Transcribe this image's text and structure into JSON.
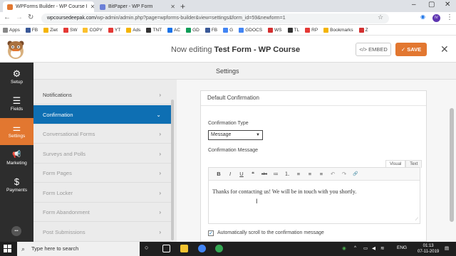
{
  "browser": {
    "tabs": [
      {
        "title": "WPForms Builder - WP Course I",
        "favicon_color": "#e27730",
        "active": true
      },
      {
        "title": "BitPaper - WP Form",
        "favicon_color": "#6b7fd7",
        "active": false
      }
    ],
    "url_host": "wpcoursedeepak.com",
    "url_path": "/wp-admin/admin.php?page=wpforms-builder&view=settings&form_id=59&newform=1",
    "profile_initials": "IV",
    "bookmarks": [
      {
        "label": "Apps",
        "color": "#888888"
      },
      {
        "label": "FB",
        "color": "#3b5998"
      },
      {
        "label": "Ziet",
        "color": "#f4b400"
      },
      {
        "label": "SW",
        "color": "#e53935"
      },
      {
        "label": "COPY",
        "color": "#fbc02d"
      },
      {
        "label": "YT",
        "color": "#e53935"
      },
      {
        "label": "Ads",
        "color": "#f4b400"
      },
      {
        "label": "TNT",
        "color": "#333333"
      },
      {
        "label": "AC",
        "color": "#1a73e8"
      },
      {
        "label": "GD",
        "color": "#0f9d58"
      },
      {
        "label": "FB",
        "color": "#3b5998"
      },
      {
        "label": "G",
        "color": "#4285f4"
      },
      {
        "label": "GDOCS",
        "color": "#4285f4"
      },
      {
        "label": "WS",
        "color": "#d32f2f"
      },
      {
        "label": "TL",
        "color": "#333333"
      },
      {
        "label": "RP",
        "color": "#e53935"
      },
      {
        "label": "Bookmarks",
        "color": "#f4b400"
      },
      {
        "label": "Z",
        "color": "#d32f2f"
      }
    ]
  },
  "header": {
    "editing_prefix": "Now editing",
    "form_name": "Test Form - WP Course",
    "embed_label": "</> EMBED",
    "save_label": "✓ SAVE",
    "close_glyph": "✕"
  },
  "sidenav": [
    {
      "label": "Setup",
      "icon": "gear-icon",
      "glyph": "⚙",
      "active": false
    },
    {
      "label": "Fields",
      "icon": "list-icon",
      "glyph": "☰",
      "active": false
    },
    {
      "label": "Settings",
      "icon": "sliders-icon",
      "glyph": "⚌",
      "active": true
    },
    {
      "label": "Marketing",
      "icon": "megaphone-icon",
      "glyph": "📢",
      "active": false
    },
    {
      "label": "Payments",
      "icon": "dollar-icon",
      "glyph": "$",
      "active": false
    }
  ],
  "sidenav_more_glyph": "•••",
  "settings_title": "Settings",
  "panel_items": [
    {
      "label": "Notifications",
      "chevron": "›",
      "state": "normal"
    },
    {
      "label": "Confirmation",
      "chevron": "⌄",
      "state": "active"
    },
    {
      "label": "Conversational Forms",
      "chevron": "›",
      "state": "muted"
    },
    {
      "label": "Surveys and Polls",
      "chevron": "›",
      "state": "muted"
    },
    {
      "label": "Form Pages",
      "chevron": "›",
      "state": "muted"
    },
    {
      "label": "Form Locker",
      "chevron": "›",
      "state": "muted"
    },
    {
      "label": "Form Abandonment",
      "chevron": "›",
      "state": "muted"
    },
    {
      "label": "Post Submissions",
      "chevron": "›",
      "state": "muted"
    }
  ],
  "confirmation": {
    "section_title": "Default Confirmation",
    "type_label": "Confirmation Type",
    "type_value": "Message",
    "message_label": "Confirmation Message",
    "tab_visual": "Visual",
    "tab_text": "Text",
    "toolbar": [
      "B",
      "I",
      "U",
      "❝",
      "abc",
      "≔",
      "⒈",
      "≡",
      "≡",
      "≡",
      "↶",
      "↷",
      "🔗"
    ],
    "message_text": "Thanks for contacting us! We will be in touch with you shortly.",
    "autoscroll_label": "Automatically scroll to the confirmation message",
    "autoscroll_checked": true
  },
  "taskbar": {
    "search_placeholder": "Type here to search",
    "language": "ENG",
    "time": "01:13",
    "date": "07-11-2019"
  },
  "colors": {
    "accent_orange": "#e27730",
    "active_blue": "#0e6fb3",
    "sidenav_bg": "#2d2d2d"
  }
}
